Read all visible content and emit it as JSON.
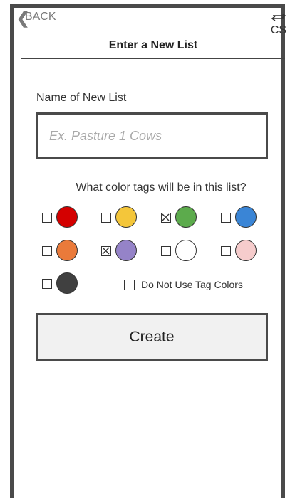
{
  "nav": {
    "back_label": "BACK",
    "back_icon": "chevron-left-icon",
    "app_icon_text": "CS",
    "app_icon_name": "swap-arrows-icon"
  },
  "header": {
    "title": "Enter a New List"
  },
  "form": {
    "name_label": "Name of New List",
    "name_placeholder": "Ex. Pasture 1 Cows",
    "name_value": "",
    "tags_question": "What color tags will be in this list?",
    "tags": [
      {
        "color_name": "red",
        "color": "#d40000",
        "checked": false
      },
      {
        "color_name": "yellow",
        "color": "#f4c63a",
        "checked": false
      },
      {
        "color_name": "green",
        "color": "#5cab4c",
        "checked": true
      },
      {
        "color_name": "blue",
        "color": "#3a85d6",
        "checked": false
      },
      {
        "color_name": "orange",
        "color": "#ea7a3a",
        "checked": false
      },
      {
        "color_name": "purple",
        "color": "#9583c8",
        "checked": true
      },
      {
        "color_name": "white",
        "color": "#ffffff",
        "checked": false
      },
      {
        "color_name": "pink",
        "color": "#f6cccc",
        "checked": false
      },
      {
        "color_name": "black",
        "color": "#404040",
        "checked": false
      }
    ],
    "no_tags_label": "Do Not Use Tag Colors",
    "no_tags_checked": false,
    "create_label": "Create"
  }
}
